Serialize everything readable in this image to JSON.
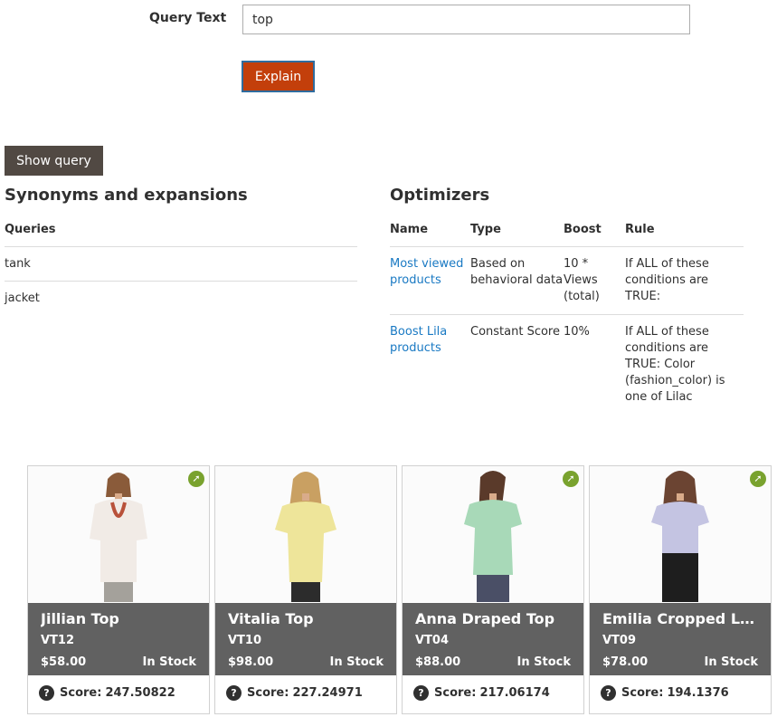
{
  "query": {
    "label": "Query Text",
    "value": "top",
    "explain_label": "Explain"
  },
  "show_query_label": "Show query",
  "synonyms": {
    "title": "Synonyms and expansions",
    "column": "Queries",
    "rows": [
      "tank",
      "jacket"
    ]
  },
  "optimizers": {
    "title": "Optimizers",
    "columns": {
      "name": "Name",
      "type": "Type",
      "boost": "Boost",
      "rule": "Rule"
    },
    "rows": [
      {
        "name": "Most viewed products",
        "type": "Based on behavioral data",
        "boost": "10 * Views (total)",
        "rule": "If ALL of these conditions are TRUE:"
      },
      {
        "name": "Boost Lila products",
        "type": "Constant Score",
        "boost": "10%",
        "rule": "If ALL of these conditions are TRUE: Color (fashion_color) is one of Lilac"
      }
    ]
  },
  "products": [
    {
      "name": "Jillian Top",
      "sku": "VT12",
      "price": "$58.00",
      "stock": "In Stock",
      "score_label": "Score:",
      "score": "247.50822",
      "shirt_color": "#f1ebe6",
      "necklace": true
    },
    {
      "name": "Vitalia Top",
      "sku": "VT10",
      "price": "$98.00",
      "stock": "In Stock",
      "score_label": "Score:",
      "score": "227.24971",
      "shirt_color": "#eee59a",
      "necklace": false
    },
    {
      "name": "Anna Draped Top",
      "sku": "VT04",
      "price": "$88.00",
      "stock": "In Stock",
      "score_label": "Score:",
      "score": "217.06174",
      "shirt_color": "#a8d9b8",
      "necklace": false
    },
    {
      "name": "Emilia Cropped Lac...",
      "sku": "VT09",
      "price": "$78.00",
      "stock": "In Stock",
      "score_label": "Score:",
      "score": "194.1376",
      "shirt_color": "#c4c4e2",
      "necklace": false
    }
  ],
  "colors": {
    "explain_button": "#c33f0b",
    "show_query_button": "#514943",
    "product_info_bg": "#616161",
    "link_icon": "#79a22e",
    "link_text": "#1979c3"
  },
  "icons": {
    "external_link": "arrow-up-right-icon",
    "help": "question-circle-icon"
  }
}
